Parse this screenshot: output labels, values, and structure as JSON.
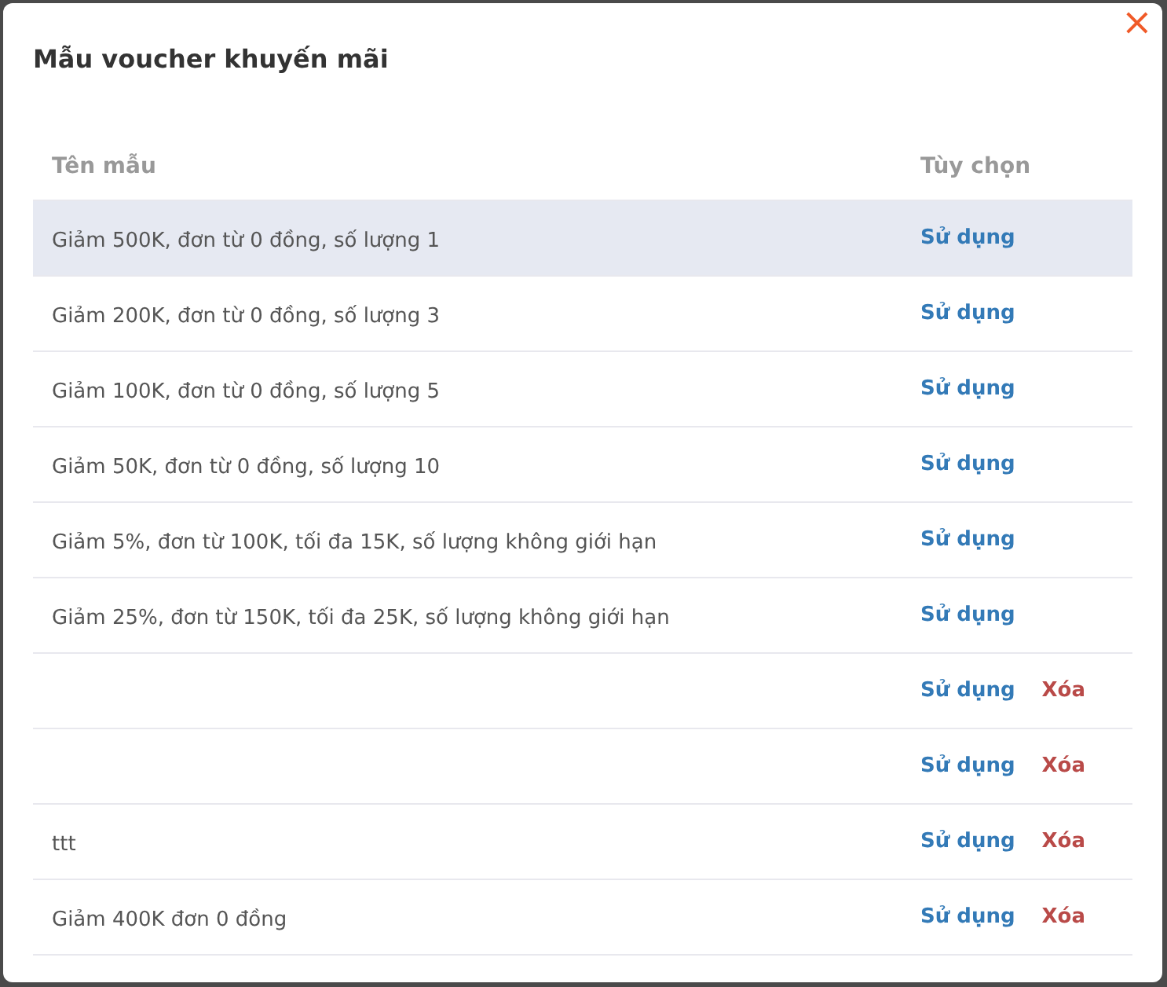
{
  "dialog": {
    "title": "Mẫu voucher khuyến mãi",
    "close": "×"
  },
  "table": {
    "columns": [
      "Tên mẫu",
      "Tùy chọn"
    ],
    "rows": [
      {
        "name": "Giảm 500K, đơn từ 0 đồng, số lượng 1",
        "highlighted": true,
        "actions": [
          {
            "kind": "use",
            "label": "Sử dụng"
          }
        ]
      },
      {
        "name": "Giảm 200K, đơn từ 0 đồng, số lượng 3",
        "highlighted": false,
        "actions": [
          {
            "kind": "use",
            "label": "Sử dụng"
          }
        ]
      },
      {
        "name": "Giảm 100K, đơn từ 0 đồng, số lượng 5",
        "highlighted": false,
        "actions": [
          {
            "kind": "use",
            "label": "Sử dụng"
          }
        ]
      },
      {
        "name": "Giảm 50K, đơn từ 0 đồng, số lượng 10",
        "highlighted": false,
        "actions": [
          {
            "kind": "use",
            "label": "Sử dụng"
          }
        ]
      },
      {
        "name": "Giảm 5%, đơn từ 100K, tối đa 15K, số lượng không giới hạn",
        "highlighted": false,
        "actions": [
          {
            "kind": "use",
            "label": "Sử dụng"
          }
        ]
      },
      {
        "name": "Giảm 25%, đơn từ 150K, tối đa 25K, số lượng không giới hạn",
        "highlighted": false,
        "actions": [
          {
            "kind": "use",
            "label": "Sử dụng"
          }
        ]
      },
      {
        "highlighted": false,
        "actions": [
          {
            "kind": "use",
            "label": "Sử dụng"
          },
          {
            "kind": "delete",
            "label": "Xóa"
          }
        ]
      },
      {
        "highlighted": false,
        "actions": [
          {
            "kind": "use",
            "label": "Sử dụng"
          },
          {
            "kind": "delete",
            "label": "Xóa"
          }
        ]
      },
      {
        "name": "ttt",
        "highlighted": false,
        "actions": [
          {
            "kind": "use",
            "label": "Sử dụng"
          },
          {
            "kind": "delete",
            "label": "Xóa"
          }
        ]
      },
      {
        "name": "Giảm 400K đơn 0 đồng",
        "highlighted": false,
        "actions": [
          {
            "kind": "use",
            "label": "Sử dụng"
          },
          {
            "kind": "delete",
            "label": "Xóa"
          }
        ]
      }
    ]
  }
}
